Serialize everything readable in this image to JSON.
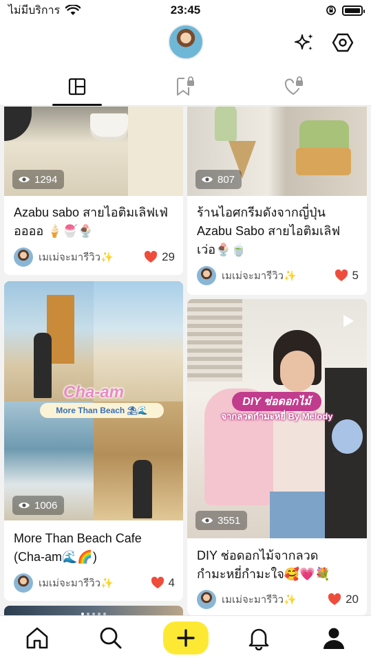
{
  "status": {
    "carrier": "ไม่มีบริการ",
    "time": "23:45"
  },
  "tabs": [
    {
      "name": "posts",
      "active": true
    },
    {
      "name": "saved-locked",
      "active": false
    },
    {
      "name": "liked-locked",
      "active": false
    }
  ],
  "posts": [
    {
      "views": "1294",
      "title": "Azabu sabo สายไอติมเลิฟเฟ่ออออ 🍦🍧🍨",
      "author": "เมเม่จะมารีวิว✨",
      "likes": "29"
    },
    {
      "views": "807",
      "title": "ร้านไอศกรีมดังจากญี่ปุ่น Azabu Sabo สายไอติมเลิฟเว่อ🍨🍵",
      "author": "เมเม่จะมารีวิว✨",
      "likes": "5"
    },
    {
      "views": "1006",
      "title": "More Than Beach Cafe (Cha-am🌊🌈)",
      "author": "เมเม่จะมารีวิว✨",
      "likes": "4",
      "overlay_title": "Cha-am",
      "overlay_sub": "More Than Beach ⛱🌊"
    },
    {
      "views": "3551",
      "title": "DIY ช่อดอกไม้จากลวดกำมะหยี่กำมะใจ🥰💗💐",
      "author": "เมเม่จะมารีวิว✨",
      "likes": "20",
      "overlay_title": "DIY ช่อดอกไม้",
      "overlay_sub": "จากลวดกำมะหยี่ By Melody"
    }
  ],
  "colors": {
    "accent": "#fde934",
    "heart": "#ee4d3c"
  }
}
